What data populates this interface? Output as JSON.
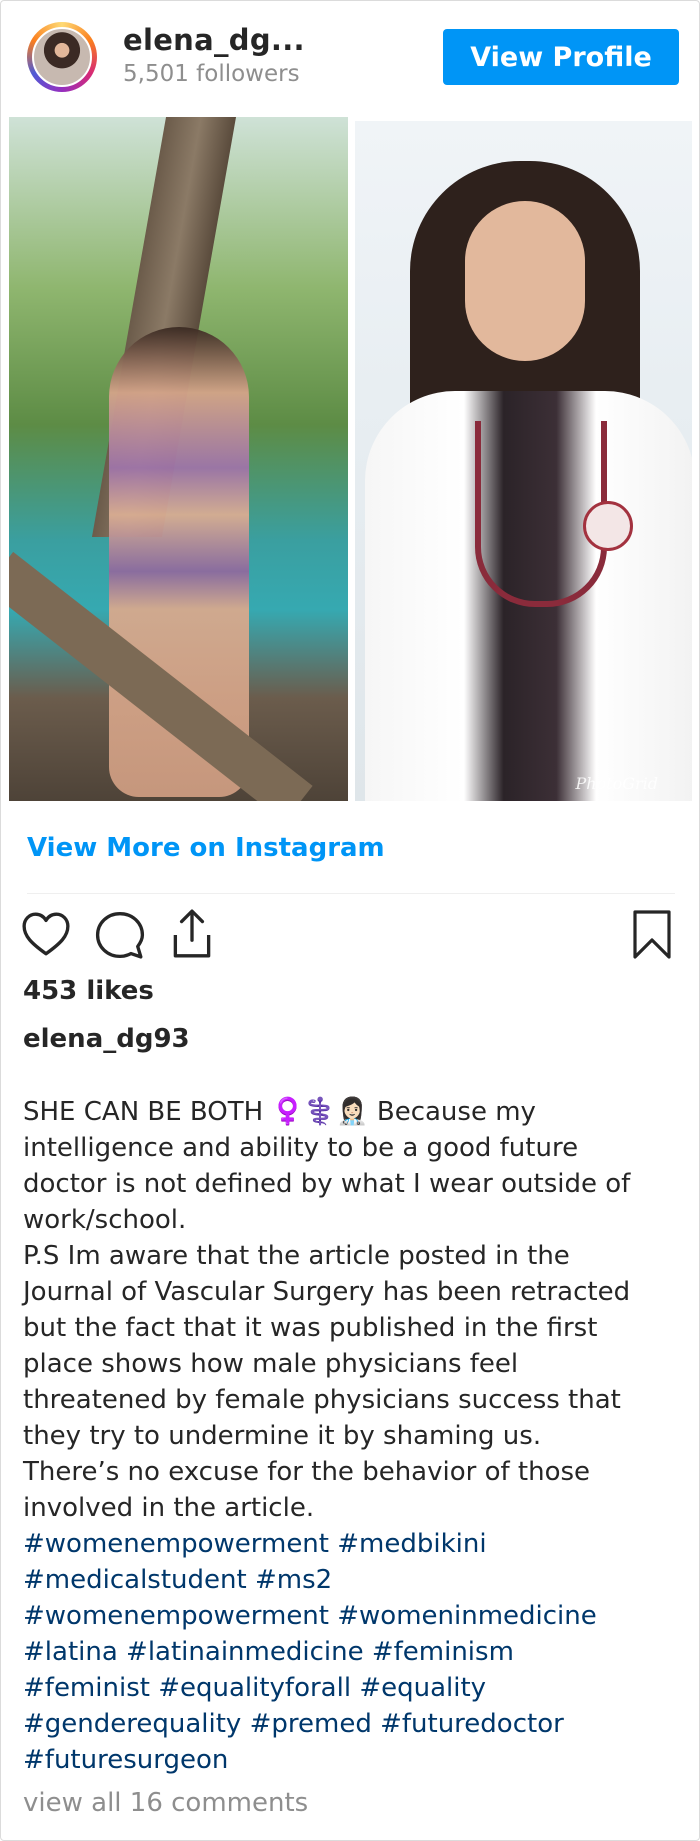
{
  "header": {
    "username": "elena_dg...",
    "followers": "5,501 followers",
    "view_profile_label": "View Profile"
  },
  "media": {
    "watermark": "PhotoGrid"
  },
  "link": {
    "view_more_label": "View More on Instagram"
  },
  "actions": {
    "icons": [
      "heart-icon",
      "comment-icon",
      "share-icon",
      "bookmark-icon"
    ]
  },
  "post": {
    "likes": "453 likes",
    "username": "elena_dg93",
    "caption_lines": [
      "SHE CAN BE BOTH ♀️⚕️👩🏻‍⚕️ Because my",
      "intelligence and ability to be a good future",
      "doctor is not defined by what I wear outside of",
      "work/school.",
      "P.S Im aware that the article posted in the",
      "Journal of Vascular Surgery has been retracted",
      "but the fact that it was published in the first",
      "place shows how male physicians feel",
      "threatened by female physicians success that",
      "they try to undermine it by shaming us.",
      "There’s no excuse for the behavior of those",
      "involved in the article."
    ],
    "hashtag_lines": [
      [
        "#womenempowerment",
        "#medbikini"
      ],
      [
        "#medicalstudent",
        "#ms2"
      ],
      [
        "#womenempowerment",
        "#womeninmedicine"
      ],
      [
        "#latina",
        "#latinainmedicine",
        "#feminism"
      ],
      [
        "#feminist",
        "#equalityforall",
        "#equality"
      ],
      [
        "#genderequality",
        "#premed",
        "#futuredoctor"
      ],
      [
        "#futuresurgeon"
      ]
    ],
    "view_comments": "view all 16 comments"
  },
  "colors": {
    "accent_blue": "#0095f6",
    "hashtag": "#00376b",
    "muted": "#8e8e8e",
    "text": "#262626"
  }
}
